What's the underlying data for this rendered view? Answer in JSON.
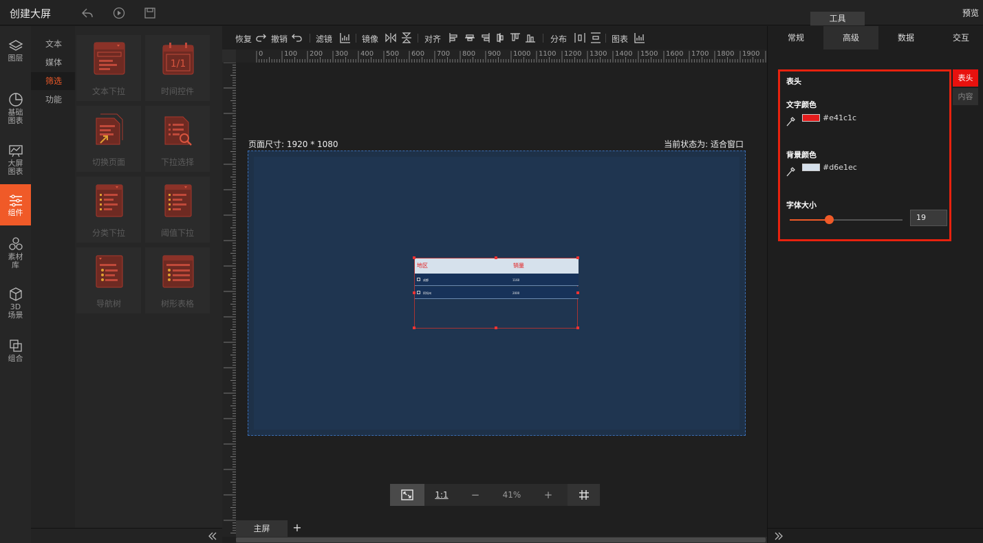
{
  "app": {
    "title": "创建大屏",
    "preview": "预览",
    "tool_tab": "工具"
  },
  "leftnav": [
    {
      "label": "图层",
      "icon": "layers-icon"
    },
    {
      "label": "基础图表",
      "icon": "pie-chart-icon"
    },
    {
      "label": "大屏图表",
      "icon": "monitor-chart-icon"
    },
    {
      "label": "组件",
      "icon": "sliders-icon"
    },
    {
      "label": "素材库",
      "icon": "hexagons-icon"
    },
    {
      "label": "3D场景",
      "icon": "cube-icon"
    },
    {
      "label": "组合",
      "icon": "group-icon"
    }
  ],
  "subnav": [
    "文本",
    "媒体",
    "筛选",
    "功能"
  ],
  "components": [
    "文本下拉",
    "时间控件",
    "切换页面",
    "下拉选择",
    "分类下拉",
    "阈值下拉",
    "导航树",
    "树形表格"
  ],
  "toolbar": {
    "redo": "恢复",
    "undo": "撤销",
    "filter": "滤镜",
    "mirror": "镜像",
    "align": "对齐",
    "distribute": "分布",
    "chart": "图表"
  },
  "ruler_labels": [
    "0",
    "100",
    "200",
    "300",
    "400",
    "500",
    "600",
    "700",
    "800",
    "900",
    "1000",
    "1100",
    "1200",
    "1300",
    "1400",
    "1500",
    "1600",
    "1700",
    "1800",
    "1900",
    "20"
  ],
  "canvas": {
    "page_size": "页面尺寸: 1920 * 1080",
    "status": "当前状态为: 适合窗口"
  },
  "table": {
    "headers": [
      "地区",
      "销量"
    ],
    "rows": [
      [
        "成都",
        "1160"
      ],
      [
        "阿坝州",
        "2000"
      ]
    ]
  },
  "zoom": {
    "ratio": "1:1",
    "minus": "−",
    "value": "41%",
    "plus": "+"
  },
  "pages": {
    "main": "主屏",
    "add": "+"
  },
  "rightpanel": {
    "tabs": [
      "常规",
      "高级",
      "数据",
      "交互"
    ],
    "section": "表头",
    "text_color_label": "文字颜色",
    "text_color": "#e41c1c",
    "bg_color_label": "背景颜色",
    "bg_color": "#d6e1ec",
    "font_size_label": "字体大小",
    "font_size": "19",
    "font_size_level": 0.35,
    "side_tabs": [
      "表头",
      "内容"
    ]
  },
  "colors": {
    "accent": "#f05a28",
    "highlight": "#e8220e",
    "screen_bg": "#1e3148"
  }
}
